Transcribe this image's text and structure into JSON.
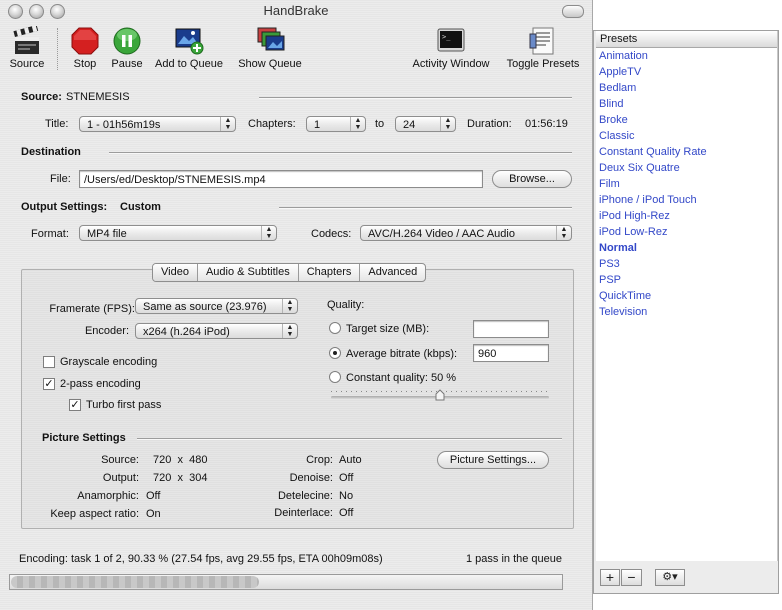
{
  "window": {
    "title": "HandBrake"
  },
  "toolbar": {
    "source": "Source",
    "stop": "Stop",
    "pause": "Pause",
    "add_to_queue": "Add to Queue",
    "show_queue": "Show Queue",
    "activity_window": "Activity Window",
    "toggle_presets": "Toggle Presets"
  },
  "source": {
    "label": "Source:",
    "name": "STNEMESIS",
    "title_label": "Title:",
    "title_value": "1 - 01h56m19s",
    "chapters_label": "Chapters:",
    "chapter_start": "1",
    "to_label": "to",
    "chapter_end": "24",
    "duration_label": "Duration:",
    "duration_value": "01:56:19"
  },
  "destination": {
    "heading": "Destination",
    "file_label": "File:",
    "file_path": "/Users/ed/Desktop/STNEMESIS.mp4",
    "browse_button": "Browse..."
  },
  "output": {
    "heading": "Output Settings:",
    "preset_name": "Custom",
    "format_label": "Format:",
    "format_value": "MP4 file",
    "codecs_label": "Codecs:",
    "codecs_value": "AVC/H.264 Video / AAC Audio"
  },
  "tabs": [
    {
      "label": "Video",
      "selected": true
    },
    {
      "label": "Audio & Subtitles"
    },
    {
      "label": "Chapters"
    },
    {
      "label": "Advanced"
    }
  ],
  "video": {
    "framerate_label": "Framerate (FPS):",
    "framerate_value": "Same as source (23.976)",
    "encoder_label": "Encoder:",
    "encoder_value": "x264 (h.264 iPod)",
    "grayscale_label": "Grayscale encoding",
    "grayscale_checked": false,
    "two_pass_label": "2-pass encoding",
    "two_pass_checked": true,
    "turbo_label": "Turbo first pass",
    "turbo_checked": true,
    "check_mark": "✓",
    "quality_label": "Quality:",
    "target_size_label": "Target size (MB):",
    "target_size_value": "",
    "avg_bitrate_label": "Average bitrate (kbps):",
    "avg_bitrate_value": "960",
    "constant_quality_label": "Constant quality: 50 %",
    "quality_slider_level": 0.5
  },
  "picture": {
    "heading": "Picture Settings",
    "source_label": "Source:",
    "source_value": "720  x  480",
    "output_label": "Output:",
    "output_value": "720  x  304",
    "anamorphic_label": "Anamorphic:",
    "anamorphic_value": "Off",
    "keep_aspect_label": "Keep aspect ratio:",
    "keep_aspect_value": "On",
    "crop_label": "Crop:",
    "crop_value": "Auto",
    "denoise_label": "Denoise:",
    "denoise_value": "Off",
    "detelecine_label": "Detelecine:",
    "detelecine_value": "No",
    "deinterlace_label": "Deinterlace:",
    "deinterlace_value": "Off",
    "settings_button": "Picture Settings..."
  },
  "status": {
    "encoding_text": "Encoding: task 1 of 2, 90.33 % (27.54 fps, avg 29.55 fps, ETA 00h09m08s)",
    "queue_text": "1 pass in the queue",
    "progress": 0.45
  },
  "presets": {
    "header": "Presets",
    "items": [
      {
        "label": "Animation"
      },
      {
        "label": "AppleTV"
      },
      {
        "label": "Bedlam"
      },
      {
        "label": "Blind"
      },
      {
        "label": "Broke"
      },
      {
        "label": "Classic"
      },
      {
        "label": "Constant Quality Rate"
      },
      {
        "label": "Deux Six Quatre"
      },
      {
        "label": "Film"
      },
      {
        "label": "iPhone / iPod Touch"
      },
      {
        "label": "iPod High-Rez"
      },
      {
        "label": "iPod Low-Rez"
      },
      {
        "label": "Normal",
        "bold": true
      },
      {
        "label": "PS3"
      },
      {
        "label": "PSP"
      },
      {
        "label": "QuickTime"
      },
      {
        "label": "Television"
      }
    ],
    "add_button": "+",
    "remove_button": "−",
    "gear_symbol": "⚙▾"
  },
  "colors": {
    "preset_link": "#3348c8",
    "stop_red": "#d42020",
    "pause_green": "#3aa63a"
  }
}
